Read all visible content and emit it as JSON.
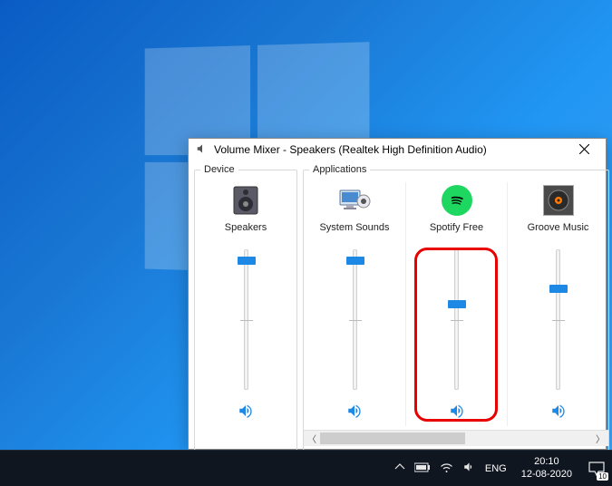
{
  "window": {
    "title": "Volume Mixer - Speakers (Realtek High Definition Audio)",
    "device_section_label": "Device",
    "apps_section_label": "Applications"
  },
  "channels": {
    "device": {
      "label": "Speakers",
      "volume": 95,
      "muted": false
    },
    "apps": [
      {
        "label": "System Sounds",
        "volume": 95,
        "muted": false,
        "highlighted": false
      },
      {
        "label": "Spotify Free",
        "volume": 62,
        "muted": false,
        "highlighted": true
      },
      {
        "label": "Groove Music",
        "volume": 74,
        "muted": false,
        "highlighted": false
      }
    ]
  },
  "taskbar": {
    "language": "ENG",
    "time": "20:10",
    "date": "12-08-2020",
    "notification_count": "10"
  }
}
